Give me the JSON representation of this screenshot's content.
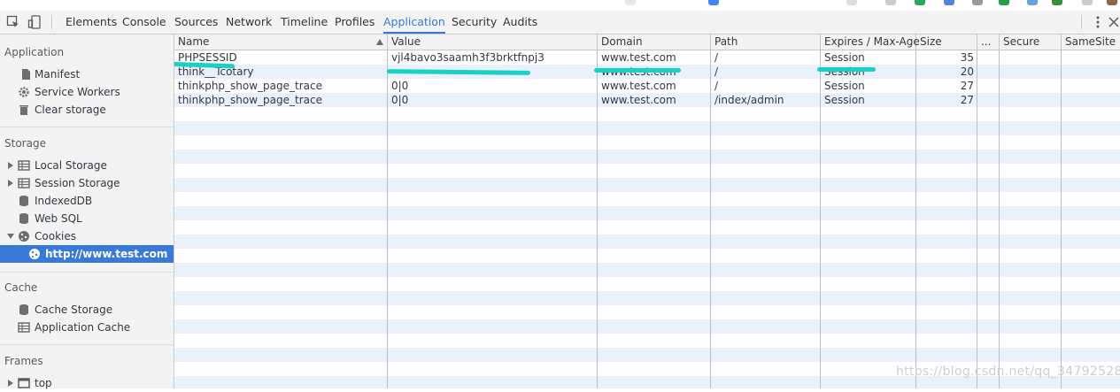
{
  "toolbar": {
    "tabs": [
      {
        "label": "Elements"
      },
      {
        "label": "Console"
      },
      {
        "label": "Sources"
      },
      {
        "label": "Network"
      },
      {
        "label": "Timeline"
      },
      {
        "label": "Profiles"
      },
      {
        "label": "Application",
        "active": true
      },
      {
        "label": "Security"
      },
      {
        "label": "Audits"
      }
    ],
    "icons": [
      "inspect-element-icon",
      "device-toolbar-icon",
      "more-menu-icon",
      "close-icon"
    ]
  },
  "sidebar": {
    "application": {
      "title": "Application",
      "items": [
        {
          "label": "Manifest",
          "icon": "manifest-icon"
        },
        {
          "label": "Service Workers",
          "icon": "gear-icon"
        },
        {
          "label": "Clear storage",
          "icon": "trash-icon"
        }
      ]
    },
    "storage": {
      "title": "Storage",
      "items": [
        {
          "label": "Local Storage",
          "icon": "grid-icon",
          "expandable": true
        },
        {
          "label": "Session Storage",
          "icon": "grid-icon",
          "expandable": true
        },
        {
          "label": "IndexedDB",
          "icon": "database-icon"
        },
        {
          "label": "Web SQL",
          "icon": "database-icon"
        },
        {
          "label": "Cookies",
          "icon": "cookie-icon",
          "expanded": true
        },
        {
          "label": "http://www.test.com",
          "icon": "cookie-icon",
          "selected": true
        }
      ]
    },
    "cache": {
      "title": "Cache",
      "items": [
        {
          "label": "Cache Storage",
          "icon": "database-icon"
        },
        {
          "label": "Application Cache",
          "icon": "grid-icon"
        }
      ]
    },
    "frames": {
      "title": "Frames",
      "items": [
        {
          "label": "top",
          "icon": "frame-icon",
          "expandable": true
        }
      ]
    }
  },
  "table": {
    "columns": [
      "Name",
      "Value",
      "Domain",
      "Path",
      "Expires / Max-Age",
      "Size",
      "...",
      "Secure",
      "SameSite"
    ],
    "sorted_column": "Name",
    "rows": [
      {
        "name": "PHPSESSID",
        "value": "vjl4bavo3saamh3f3brktfnpj3",
        "domain": "www.test.com",
        "path": "/",
        "expires": "Session",
        "size": "35"
      },
      {
        "name": "think__Tcotary",
        "value": "",
        "domain": "www.test.com",
        "path": "/",
        "expires": "Session",
        "size": "20"
      },
      {
        "name": "thinkphp_show_page_trace",
        "value": "0|0",
        "domain": "www.test.com",
        "path": "/",
        "expires": "Session",
        "size": "27"
      },
      {
        "name": "thinkphp_show_page_trace",
        "value": "0|0",
        "domain": "www.test.com",
        "path": "/index/admin",
        "expires": "Session",
        "size": "27"
      }
    ]
  },
  "colors": {
    "accent": "#3879d9",
    "selected_row": "#3879d9",
    "stripe": "#eaf1fb",
    "marker": "#17d1c6"
  },
  "watermark": "https://blog.csdn.net/qq_34792528"
}
